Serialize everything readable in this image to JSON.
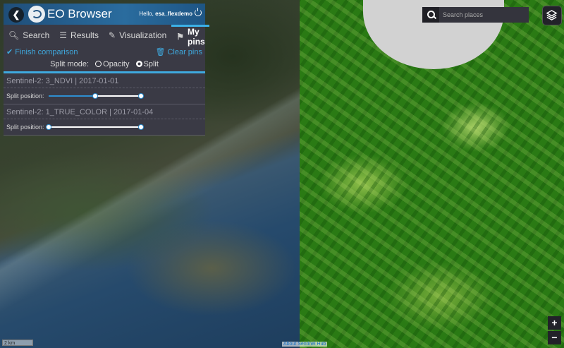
{
  "app": {
    "title": "EO Browser",
    "greeting_prefix": "Hello, ",
    "username": "esa_flexdemo"
  },
  "tabs": [
    {
      "label": "Search",
      "icon": "search-icon"
    },
    {
      "label": "Results",
      "icon": "sliders-icon"
    },
    {
      "label": "Visualization",
      "icon": "brush-icon"
    },
    {
      "label": "My pins",
      "icon": "pin-icon",
      "active": true
    }
  ],
  "comparison": {
    "finish_label": "Finish comparison",
    "clear_label": "Clear pins",
    "split_mode_label": "Split mode:",
    "options": [
      "Opacity",
      "Split"
    ],
    "selected": "Split"
  },
  "pins": [
    {
      "title": "Sentinel-2: 3_NDVI | 2017-01-01",
      "slider_label": "Split position:",
      "range": [
        0.5,
        1.0
      ]
    },
    {
      "title": "Sentinel-2: 1_TRUE_COLOR | 2017-01-04",
      "slider_label": "Split position:",
      "range": [
        0.0,
        1.0
      ]
    }
  ],
  "search": {
    "placeholder": "Search places"
  },
  "zoom": {
    "in": "+",
    "out": "−"
  },
  "scale": "2 km",
  "attribution": "About Sentinel Hub",
  "colors": {
    "accent": "#3fa9de",
    "panel": "#3a3a45",
    "header": "#2a6c9e"
  }
}
